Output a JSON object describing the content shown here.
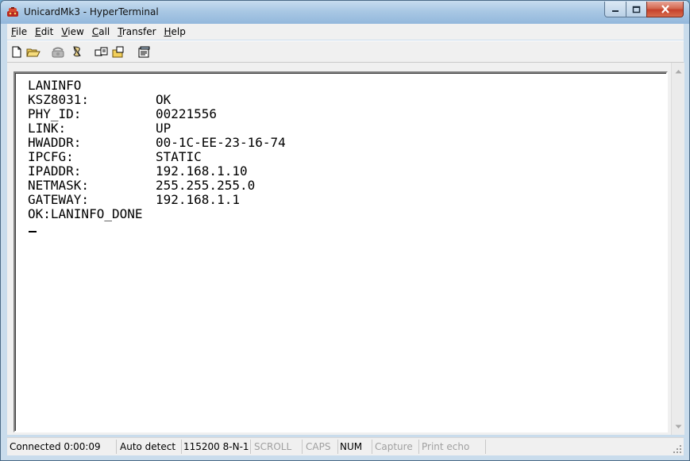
{
  "window": {
    "title": "UnicardMk3 - HyperTerminal",
    "close_color": "#c5412b",
    "titlebar_color": "#a9c8e4"
  },
  "menu": {
    "items": [
      {
        "first": "F",
        "rest": "ile"
      },
      {
        "first": "E",
        "rest": "dit"
      },
      {
        "first": "V",
        "rest": "iew"
      },
      {
        "first": "C",
        "rest": "all"
      },
      {
        "first": "T",
        "rest": "ransfer"
      },
      {
        "first": "H",
        "rest": "elp"
      }
    ]
  },
  "toolbar": {
    "icons": [
      "new-file-icon",
      "open-folder-icon",
      "phone-icon",
      "disconnect-icon",
      "send-icon",
      "receive-icon",
      "properties-icon"
    ]
  },
  "terminal": {
    "header": "LANINFO",
    "rows": [
      {
        "key": "KSZ8031:",
        "value": "OK"
      },
      {
        "key": "PHY_ID:",
        "value": "00221556"
      },
      {
        "key": "LINK:",
        "value": "UP"
      },
      {
        "key": "HWADDR:",
        "value": "00-1C-EE-23-16-74"
      },
      {
        "key": "IPCFG:",
        "value": "STATIC"
      },
      {
        "key": "IPADDR:",
        "value": "192.168.1.10"
      },
      {
        "key": "NETMASK:",
        "value": "255.255.255.0"
      },
      {
        "key": "GATEWAY:",
        "value": "192.168.1.1"
      }
    ],
    "footer": "OK:LANINFO_DONE"
  },
  "status": {
    "connected": "Connected 0:00:09",
    "detect": "Auto detect",
    "port": "115200 8-N-1",
    "scroll": "SCROLL",
    "caps": "CAPS",
    "num": "NUM",
    "capture": "Capture",
    "print_echo": "Print echo"
  }
}
